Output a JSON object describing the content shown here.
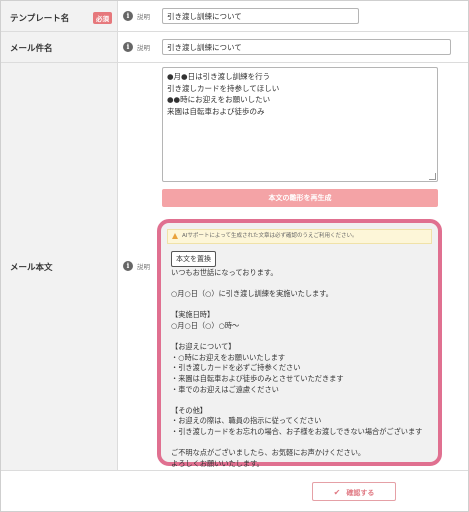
{
  "form": {
    "template_name": {
      "label": "テンプレート名",
      "required_badge": "必須",
      "help_label": "説明",
      "value": "引き渡し訓練について"
    },
    "subject": {
      "label": "メール件名",
      "help_label": "説明",
      "value": "引き渡し訓練について"
    },
    "body": {
      "label": "メール本文",
      "help_label": "説明",
      "textarea_lines": [
        "●月●日は引き渡し訓練を行う",
        "引き渡しカードを持参してほしい",
        "●●時にお迎えをお願いしたい",
        "来園は自転車および徒歩のみ"
      ],
      "regenerate_button": "本文の雛形を再生成"
    },
    "ai_panel": {
      "warning": "AIサポートによって生成された文章は必ず確認のうえご利用ください。",
      "replace_button": "本文を置換",
      "generated_lines": [
        "いつもお世話になっております。",
        "",
        "○月○日（○）に引き渡し訓練を実施いたします。",
        "",
        "【実施日時】",
        "○月○日（○）○時～",
        "",
        "【お迎えについて】",
        "・○時にお迎えをお願いいたします",
        "・引き渡しカードを必ずご持参ください",
        "・来園は自転車および徒歩のみとさせていただきます",
        "・車でのお迎えはご遠慮ください",
        "",
        "【その他】",
        "・お迎えの際は、職員の指示に従ってください",
        "・引き渡しカードをお忘れの場合、お子様をお渡しできない場合がございます",
        "",
        "ご不明な点がございましたら、お気軽にお声かけください。",
        "よろしくお願いいたします。"
      ]
    },
    "confirm_button": "確認する"
  },
  "colors": {
    "accent_pink": "#e07090",
    "badge": "#e6787c",
    "regen_button": "#f4a3a6",
    "label_bg": "#f2f2f2"
  }
}
